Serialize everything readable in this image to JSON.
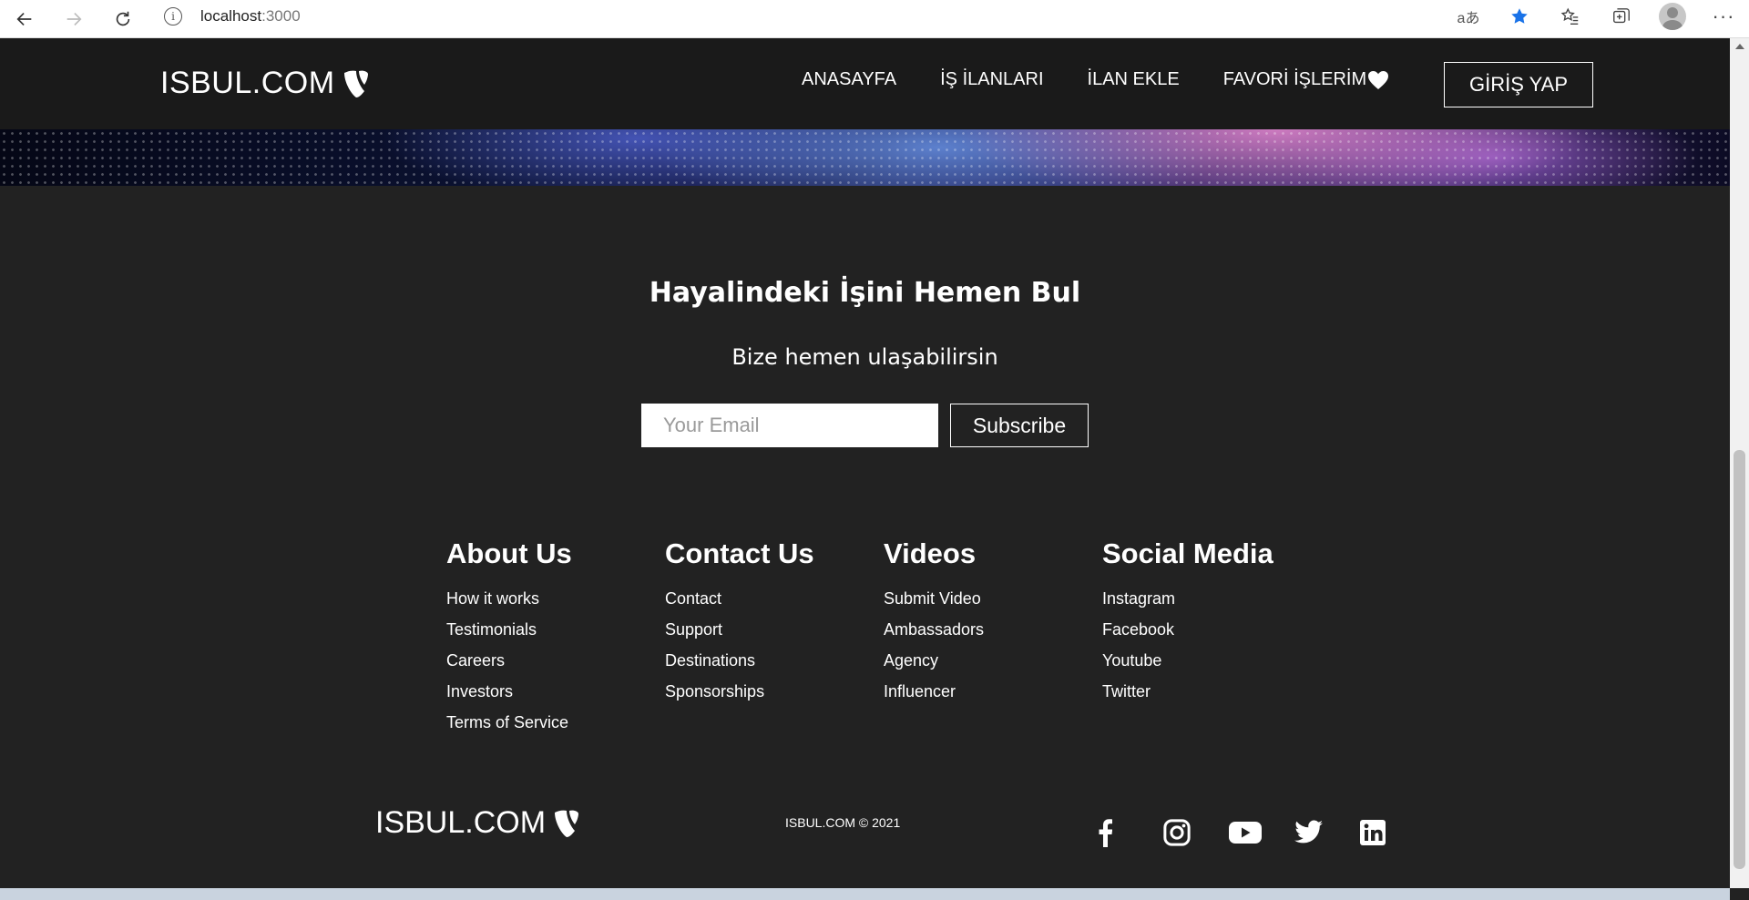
{
  "browser": {
    "url_host": "localhost",
    "url_port": ":3000"
  },
  "header": {
    "brand": "ISBUL.COM",
    "nav": [
      {
        "label": "ANASAYFA"
      },
      {
        "label": "İŞ İLANLARI"
      },
      {
        "label": "İLAN EKLE"
      },
      {
        "label": "FAVORİ İŞLERİM"
      }
    ],
    "login_label": "GİRİŞ YAP"
  },
  "subscribe": {
    "title": "Hayalindeki İşini Hemen Bul",
    "subtitle": "Bize hemen ulaşabilirsin",
    "email_placeholder": "Your Email",
    "button_label": "Subscribe"
  },
  "footer": {
    "columns": [
      {
        "heading": "About Us",
        "links": [
          "How it works",
          "Testimonials",
          "Careers",
          "Investors",
          "Terms of Service"
        ]
      },
      {
        "heading": "Contact Us",
        "links": [
          "Contact",
          "Support",
          "Destinations",
          "Sponsorships"
        ]
      },
      {
        "heading": "Videos",
        "links": [
          "Submit Video",
          "Ambassadors",
          "Agency",
          "Influencer"
        ]
      },
      {
        "heading": "Social Media",
        "links": [
          "Instagram",
          "Facebook",
          "Youtube",
          "Twitter"
        ]
      }
    ],
    "brand": "ISBUL.COM",
    "copyright": "ISBUL.COM © 2021",
    "social_icons": [
      "facebook-icon",
      "instagram-icon",
      "youtube-icon",
      "twitter-icon",
      "linkedin-icon"
    ]
  }
}
